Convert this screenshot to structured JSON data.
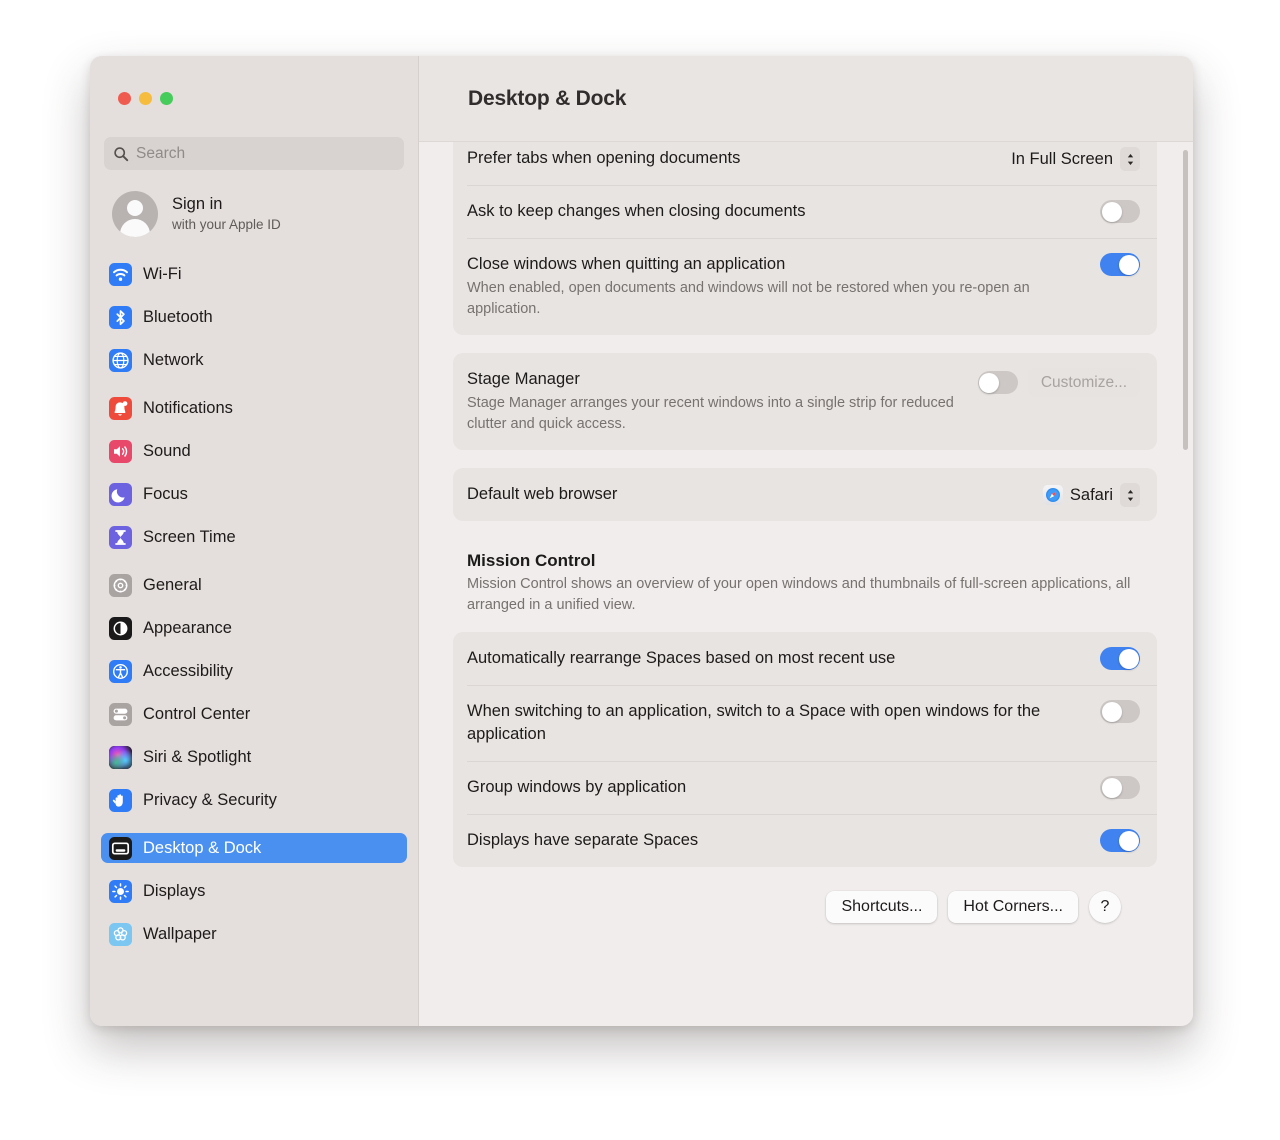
{
  "window": {
    "traffic_lights": [
      {
        "name": "close",
        "color": "#f05b50"
      },
      {
        "name": "minimize",
        "color": "#f6bc3e"
      },
      {
        "name": "zoom",
        "color": "#46cc5a"
      }
    ]
  },
  "sidebar": {
    "search": {
      "value": "",
      "placeholder": "Search",
      "icon": "search-icon"
    },
    "account": {
      "title": "Sign in",
      "subtitle": "with your Apple ID"
    },
    "groups": [
      {
        "items": [
          {
            "label": "Wi-Fi",
            "icon": "wifi-icon",
            "color": "#2f7cf6",
            "selected": false
          },
          {
            "label": "Bluetooth",
            "icon": "bluetooth-icon",
            "color": "#2f7cf6",
            "selected": false
          },
          {
            "label": "Network",
            "icon": "globe-icon",
            "color": "#2f7cf6",
            "selected": false
          }
        ]
      },
      {
        "items": [
          {
            "label": "Notifications",
            "icon": "bell-icon",
            "color": "#ef4b3c",
            "selected": false
          },
          {
            "label": "Sound",
            "icon": "speaker-icon",
            "color": "#e8486a",
            "selected": false
          },
          {
            "label": "Focus",
            "icon": "moon-icon",
            "color": "#6d63e0",
            "selected": false
          },
          {
            "label": "Screen Time",
            "icon": "hourglass-icon",
            "color": "#6d63e0",
            "selected": false
          }
        ]
      },
      {
        "items": [
          {
            "label": "General",
            "icon": "gear-icon",
            "color": "#a9a4a2",
            "selected": false
          },
          {
            "label": "Appearance",
            "icon": "appearance-icon",
            "color": "#1a1a1a",
            "selected": false
          },
          {
            "label": "Accessibility",
            "icon": "accessibility-icon",
            "color": "#2f7cf6",
            "selected": false
          },
          {
            "label": "Control Center",
            "icon": "control-center-icon",
            "color": "#a9a4a2",
            "selected": false
          },
          {
            "label": "Siri & Spotlight",
            "icon": "siri-icon",
            "color": "#2b2438",
            "selected": false
          },
          {
            "label": "Privacy & Security",
            "icon": "hand-icon",
            "color": "#2f7cf6",
            "selected": false
          }
        ]
      },
      {
        "items": [
          {
            "label": "Desktop & Dock",
            "icon": "desktop-dock-icon",
            "color": "#1a1a1a",
            "selected": true
          },
          {
            "label": "Displays",
            "icon": "brightness-icon",
            "color": "#2f7cf6",
            "selected": false
          },
          {
            "label": "Wallpaper",
            "icon": "wallpaper-icon",
            "color": "#7cc6f2",
            "selected": false
          }
        ]
      }
    ]
  },
  "header": {
    "title": "Desktop & Dock"
  },
  "main": {
    "card_windows": {
      "rows": [
        {
          "title": "Prefer tabs when opening documents",
          "control": "popup",
          "value": "In Full Screen"
        },
        {
          "title": "Ask to keep changes when closing documents",
          "control": "toggle",
          "value": "off"
        },
        {
          "title": "Close windows when quitting an application",
          "subtitle": "When enabled, open documents and windows will not be restored when you re-open an application.",
          "control": "toggle",
          "value": "on"
        }
      ]
    },
    "card_stage_manager": {
      "rows": [
        {
          "title": "Stage Manager",
          "subtitle": "Stage Manager arranges your recent windows into a single strip for reduced clutter and quick access.",
          "control": "toggle-button",
          "value": "off",
          "button_label": "Customize...",
          "button_disabled": true
        }
      ]
    },
    "card_browser": {
      "rows": [
        {
          "title": "Default web browser",
          "control": "popup-icon",
          "value": "Safari",
          "icon": "safari-icon"
        }
      ]
    },
    "mission_control": {
      "title": "Mission Control",
      "subtitle": "Mission Control shows an overview of your open windows and thumbnails of full-screen applications, all arranged in a unified view.",
      "rows": [
        {
          "title": "Automatically rearrange Spaces based on most recent use",
          "control": "toggle",
          "value": "on"
        },
        {
          "title": "When switching to an application, switch to a Space with open windows for the application",
          "control": "toggle",
          "value": "off"
        },
        {
          "title": "Group windows by application",
          "control": "toggle",
          "value": "off"
        },
        {
          "title": "Displays have separate Spaces",
          "control": "toggle",
          "value": "on"
        }
      ]
    },
    "footer": {
      "shortcuts_label": "Shortcuts...",
      "hot_corners_label": "Hot Corners...",
      "help_label": "?"
    }
  },
  "colors": {
    "accent_blue": "#3f82f0",
    "selection_blue": "#4a90f0",
    "sidebar_bg": "#e4dfdd",
    "content_bg": "#f0edec",
    "card_bg": "#e8e4e2"
  }
}
